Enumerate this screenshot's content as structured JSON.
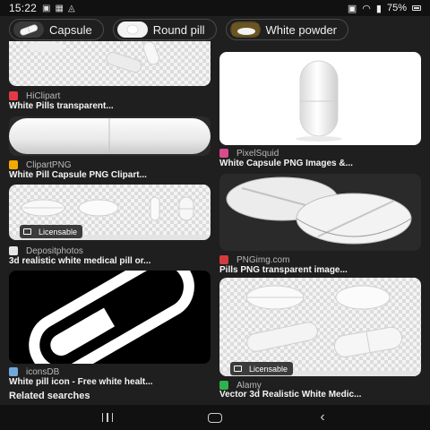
{
  "status_bar": {
    "time": "15:22",
    "battery": "75%"
  },
  "chips": [
    {
      "label": "Capsule",
      "icon": "capsule-thumb"
    },
    {
      "label": "Round pill",
      "icon": "round-pill-thumb"
    },
    {
      "label": "White powder",
      "icon": "white-powder-thumb"
    }
  ],
  "results": [
    {
      "source": "HiClipart",
      "title": "White Pills transparent...",
      "favicon_color": "#e63946",
      "licensable": false
    },
    {
      "source": "PixelSquid",
      "title": "White Capsule PNG Images &...",
      "favicon_color": "#d94b8a",
      "licensable": false
    },
    {
      "source": "ClipartPNG",
      "title": "White Pill Capsule PNG Clipart...",
      "favicon_color": "#f2a900",
      "licensable": false
    },
    {
      "source": "PNGimg.com",
      "title": "Pills PNG transparent image...",
      "favicon_color": "#d63b3b",
      "licensable": false
    },
    {
      "source": "Depositphotos",
      "title": "3d realistic white medical pill or...",
      "favicon_color": "#2d2d2d",
      "licensable": true,
      "badge": "Licensable"
    },
    {
      "source": "iconsDB",
      "title": "White pill icon - Free white healt...",
      "favicon_color": "#6fa8dc",
      "licensable": false
    },
    {
      "source": "Alamy",
      "title": "Vector 3d Realistic White Medic...",
      "favicon_color": "#2fb24c",
      "licensable": true,
      "badge": "Licensable"
    }
  ],
  "related_searches": "Related searches",
  "colors": {
    "background": "#1f1f1f",
    "text": "#f5f5f5",
    "source_text": "#b9b9b9",
    "chip_border": "#4b4b4b"
  }
}
